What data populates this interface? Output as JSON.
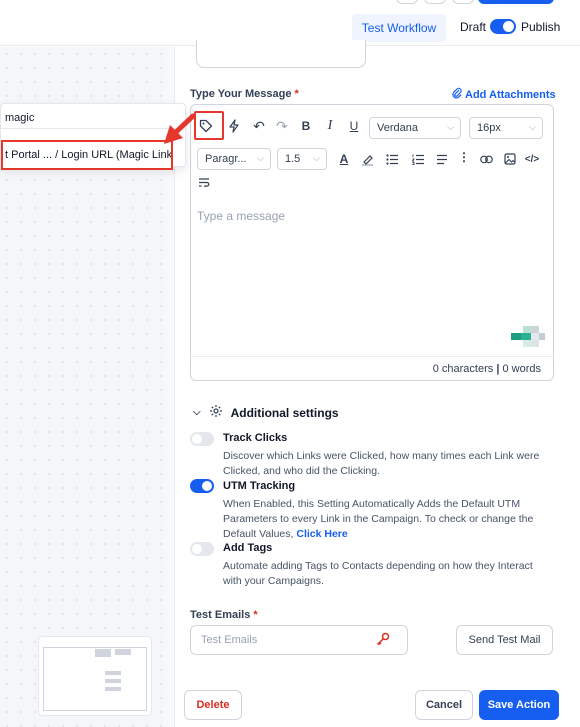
{
  "header": {
    "test_workflow_label": "Test Workflow",
    "draft_label": "Draft",
    "publish_label": "Publish"
  },
  "message": {
    "label": "Type Your Message",
    "required_mark": "*",
    "add_attachments_label": "Add Attachments",
    "placeholder": "Type a message",
    "font_family": "Verdana",
    "font_size": "16px",
    "block_format": "Paragr...",
    "line_height": "1.5",
    "characters_label": "0 characters",
    "words_label": "0 words"
  },
  "additional_settings": {
    "title": "Additional settings",
    "settings": [
      {
        "title": "Track Clicks",
        "enabled": false,
        "description": "Discover which Links were Clicked, how many times each Link were Clicked, and who did the Clicking."
      },
      {
        "title": "UTM Tracking",
        "enabled": true,
        "description": "When Enabled, this Setting Automatically Adds the Default UTM Parameters to every Link in the Campaign. To check or change the Default Values,",
        "link_text": "Click Here"
      },
      {
        "title": "Add Tags",
        "enabled": false,
        "description": "Automate adding Tags to Contacts depending on how they Interact with your Campaigns."
      }
    ]
  },
  "test_emails": {
    "label": "Test Emails",
    "required_mark": "*",
    "placeholder": "Test Emails",
    "send_button_label": "Send Test Mail"
  },
  "footer": {
    "delete_label": "Delete",
    "cancel_label": "Cancel",
    "save_label": "Save Action"
  },
  "dropdown": {
    "search_value": "magic",
    "item_label": "t Portal ... / Login URL (Magic Link)"
  },
  "colors": {
    "accent": "#155eef",
    "danger": "#d92d20",
    "highlight": "#e5372b"
  }
}
